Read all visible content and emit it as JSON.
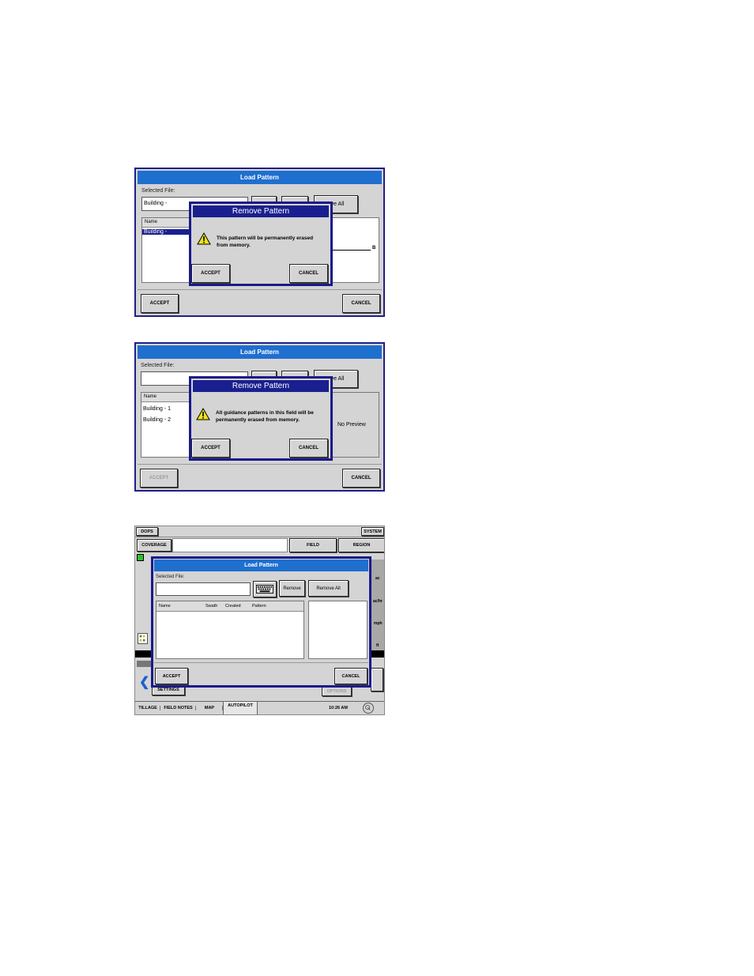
{
  "screen1": {
    "title": "Load Pattern",
    "selected_file_label": "Selected File:",
    "selected_file_value": "Building -",
    "remove_all_label": "ove All",
    "list_header_name": "Name",
    "list_item": "Building -",
    "preview_marker": "B",
    "accept_label": "ACCEPT",
    "cancel_label": "CANCEL",
    "dialog": {
      "title": "Remove Pattern",
      "message_line1": "This pattern will be permanently erased",
      "message_line2": "from memory.",
      "accept_label": "ACCEPT",
      "cancel_label": "CANCEL"
    }
  },
  "screen2": {
    "title": "Load Pattern",
    "selected_file_label": "Selected File:",
    "remove_all_label": "ove All",
    "list_header_name": "Name",
    "list_items": [
      "Building -  1",
      "Building -  2"
    ],
    "preview_text": "No Preview",
    "accept_label": "ACCEPT",
    "cancel_label": "CANCEL",
    "dialog": {
      "title": "Remove Pattern",
      "message_line1": "All guidance patterns in this field will be",
      "message_line2": "permanently erased from memory.",
      "accept_label": "ACCEPT",
      "cancel_label": "CANCEL"
    }
  },
  "screen3": {
    "top_bar": {
      "dops_label": "DOPS",
      "system_label": "SYSTEM",
      "coverage_label": "COVERAGE",
      "field_label": "FIELD",
      "region_label": "REGION"
    },
    "right_units": [
      "ac",
      "ac/hr",
      "mph",
      "ft"
    ],
    "settings_label": "SETTINGS",
    "options_label": "OPTIONS",
    "bottom_tabs": [
      "TILLAGE",
      "FIELD NOTES",
      "MAP",
      "AUTOPILOT"
    ],
    "time": "10:26 AM",
    "load_pattern": {
      "title": "Load Pattern",
      "selected_file_label": "Selected File:",
      "remove_label": "Remove",
      "remove_all_label": "Remove All",
      "columns": [
        "Name",
        "Swath",
        "Created",
        "Pattern"
      ],
      "accept_label": "ACCEPT",
      "cancel_label": "CANCEL"
    }
  },
  "colors": {
    "title_blue": "#1f6fcf",
    "dialog_navy": "#1a1f8f",
    "panel_gray": "#d4d4d4",
    "warning_yellow": "#f2e21a"
  }
}
